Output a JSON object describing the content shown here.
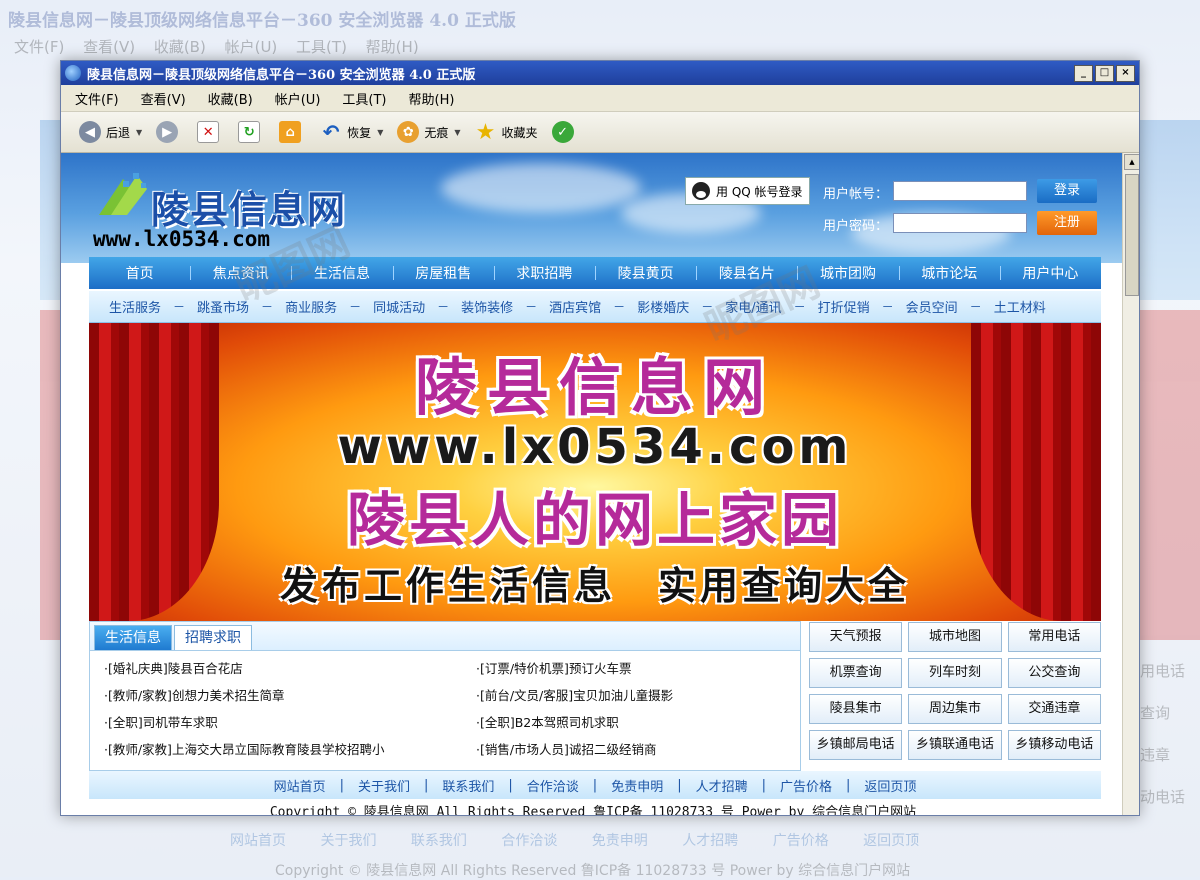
{
  "window": {
    "title": "陵县信息网－陵县顶级网络信息平台－360 安全浏览器 4.0 正式版",
    "controls": [
      "_",
      "□",
      "×"
    ]
  },
  "menu": [
    "文件(F)",
    "查看(V)",
    "收藏(B)",
    "帐户(U)",
    "工具(T)",
    "帮助(H)"
  ],
  "toolbar": {
    "back": "后退",
    "restore": "恢复",
    "incognito": "无痕",
    "favorites": "收藏夹"
  },
  "site": {
    "logo_text": "陵县信息网",
    "logo_url": "www.lx0534.com",
    "qq_login": "用 QQ 帐号登录",
    "username_label": "用户帐号：",
    "password_label": "用户密码：",
    "login_button": "登录",
    "register_button": "注册",
    "nav_main": [
      "首页",
      "焦点资讯",
      "生活信息",
      "房屋租售",
      "求职招聘",
      "陵县黄页",
      "陵县名片",
      "城市团购",
      "城市论坛",
      "用户中心"
    ],
    "nav_sub": [
      "生活服务",
      "跳蚤市场",
      "商业服务",
      "同城活动",
      "装饰装修",
      "酒店宾馆",
      "影楼婚庆",
      "家电/通讯",
      "打折促销",
      "会员空间",
      "土工材料"
    ],
    "banner": {
      "line1": "陵县信息网",
      "line2": "www.lx0534.com",
      "line3": "陵县人的网上家园",
      "line4": "发布工作生活信息　实用查询大全"
    },
    "tabs": [
      "生活信息",
      "招聘求职"
    ],
    "news": [
      "·[婚礼庆典]陵县百合花店",
      "·[订票/特价机票]预订火车票",
      "·[教师/家教]创想力美术招生简章",
      "·[前台/文员/客服]宝贝加油儿童摄影",
      "·[全职]司机带车求职",
      "·[全职]B2本驾照司机求职",
      "·[教师/家教]上海交大昂立国际教育陵县学校招聘小",
      "·[销售/市场人员]诚招二级经销商"
    ],
    "quick_links": [
      "天气预报",
      "城市地图",
      "常用电话",
      "机票查询",
      "列车时刻",
      "公交查询",
      "陵县集市",
      "周边集市",
      "交通违章",
      "乡镇邮局电话",
      "乡镇联通电话",
      "乡镇移动电话"
    ],
    "footer_links": [
      "网站首页",
      "关于我们",
      "联系我们",
      "合作洽谈",
      "免责申明",
      "人才招聘",
      "广告价格",
      "返回页顶"
    ],
    "copyright": "Copyright © 陵县信息网 All Rights Reserved 鲁ICP备 11028733 号 Power by 综合信息门户网站"
  },
  "background": {
    "title": "陵县信息网－陵县顶级网络信息平台－360 安全浏览器 4.0 正式版",
    "menu": "文件(F) 查看(V) 收藏(B) 帐户(U) 工具(T) 帮助(H)",
    "footer": "网站首页 关于我们 联系我们 合作洽谈 免责申明 人才招聘 广告价格 返回页顶",
    "copyright": "Copyright © 陵县信息网 All Rights Reserved 鲁ICP备 11028733 号 Power by 综合信息门户网站",
    "right_items": [
      "用电话",
      "查询",
      "违章",
      "动电话"
    ]
  },
  "watermark": "昵图网"
}
